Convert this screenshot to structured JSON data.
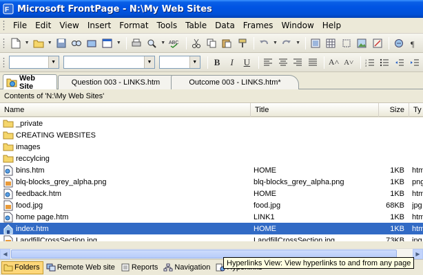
{
  "window": {
    "title": "Microsoft FrontPage - N:\\My Web Sites"
  },
  "menu": [
    "File",
    "Edit",
    "View",
    "Insert",
    "Format",
    "Tools",
    "Table",
    "Data",
    "Frames",
    "Window",
    "Help"
  ],
  "tabs": [
    {
      "label": "Web Site",
      "active": true
    },
    {
      "label": "Question 003 - LINKS.htm",
      "active": false
    },
    {
      "label": "Outcome 003 - LINKS.htm*",
      "active": false
    }
  ],
  "contents_label": "Contents of 'N:\\My Web Sites'",
  "columns": {
    "name": "Name",
    "title": "Title",
    "size": "Size",
    "type": "Ty"
  },
  "files": [
    {
      "name": "_private",
      "kind": "folder",
      "title": "",
      "size": "",
      "type": ""
    },
    {
      "name": "CREATING WEBSITES",
      "kind": "folder",
      "title": "",
      "size": "",
      "type": ""
    },
    {
      "name": "images",
      "kind": "folder",
      "title": "",
      "size": "",
      "type": ""
    },
    {
      "name": "reccylcing",
      "kind": "folder",
      "title": "",
      "size": "",
      "type": ""
    },
    {
      "name": "bins.htm",
      "kind": "htm",
      "title": "HOME",
      "size": "1KB",
      "type": "htm"
    },
    {
      "name": "blq-blocks_grey_alpha.png",
      "kind": "img",
      "title": "blq-blocks_grey_alpha.png",
      "size": "1KB",
      "type": "png"
    },
    {
      "name": "feedback.htm",
      "kind": "htm",
      "title": "HOME",
      "size": "1KB",
      "type": "htm"
    },
    {
      "name": "food.jpg",
      "kind": "img",
      "title": "food.jpg",
      "size": "68KB",
      "type": "jpg"
    },
    {
      "name": "home page.htm",
      "kind": "htm",
      "title": "LINK1",
      "size": "1KB",
      "type": "htm"
    },
    {
      "name": "index.htm",
      "kind": "home",
      "title": "HOME",
      "size": "1KB",
      "type": "htm",
      "selected": true
    },
    {
      "name": "LandfillCrossSection.jpg",
      "kind": "img",
      "title": "LandfillCrossSection.jpg",
      "size": "73KB",
      "type": "jpg"
    }
  ],
  "views": [
    {
      "label": "Folders",
      "active": true
    },
    {
      "label": "Remote Web site",
      "active": false
    },
    {
      "label": "Reports",
      "active": false
    },
    {
      "label": "Navigation",
      "active": false
    },
    {
      "label": "Hyperlinks",
      "active": false
    }
  ],
  "tooltip": "Hyperlinks View: View hyperlinks to and from any page",
  "colors": {
    "titlebar": "#0054e3",
    "selection": "#316ac5",
    "folder": "#f5d66b"
  }
}
